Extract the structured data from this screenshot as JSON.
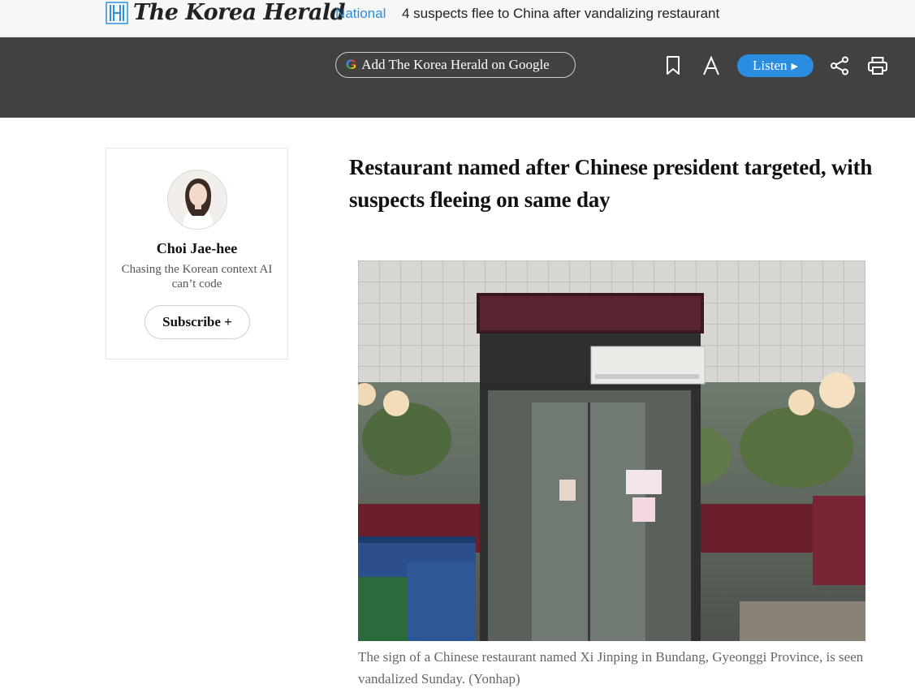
{
  "header": {
    "logo_text": "The Korea Herald",
    "section": "National",
    "headline": "4 suspects flee to China after vandalizing restaurant"
  },
  "toolbar": {
    "google_label": "Add The Korea Herald on Google",
    "listen_label": "Listen",
    "icons": [
      "bookmark-icon",
      "font-size-icon",
      "share-icon",
      "print-icon"
    ]
  },
  "author": {
    "name": "Choi Jae-hee",
    "tagline": "Chasing the Korean context AI can’t code",
    "subscribe_label": "Subscribe +"
  },
  "article": {
    "title": "Restaurant named after Chinese president targeted, with suspects fleeing on same day",
    "caption": "The sign of a Chinese restaurant named Xi Jinping in Bundang, Gyeonggi Province, is seen vandalized Sunday. (Yonhap)"
  },
  "colors": {
    "accent": "#2a8de0",
    "toolbar_bg": "#414141"
  }
}
